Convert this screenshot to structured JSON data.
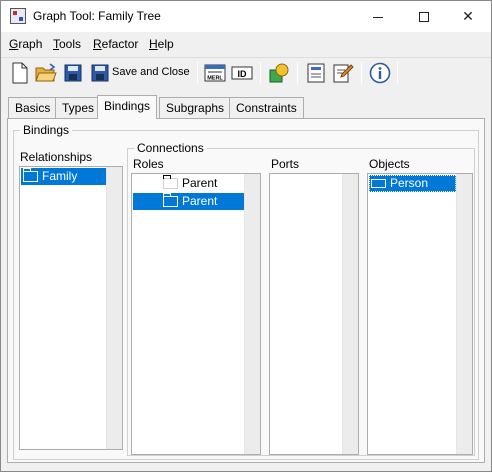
{
  "window": {
    "title": "Graph Tool: Family Tree",
    "controls": {
      "minimize": "minimize",
      "maximize": "maximize",
      "close": "close"
    }
  },
  "menu": {
    "items": [
      {
        "label": "Graph",
        "mnemonic": "G"
      },
      {
        "label": "Tools",
        "mnemonic": "T"
      },
      {
        "label": "Refactor",
        "mnemonic": "R"
      },
      {
        "label": "Help",
        "mnemonic": "H"
      }
    ]
  },
  "toolbar": {
    "save_and_close_label": "Save and Close",
    "merl_label": "MERL",
    "id_label": "ID",
    "icons": [
      "new-document-icon",
      "open-folder-icon",
      "save-disk-icon",
      "save-and-close-icon",
      "merl-icon",
      "id-icon",
      "symbol-shapes-icon",
      "form-icon",
      "edit-pencil-icon",
      "info-icon"
    ]
  },
  "tabs": [
    {
      "label": "Basics",
      "active": false
    },
    {
      "label": "Types",
      "active": false
    },
    {
      "label": "Bindings",
      "active": true
    },
    {
      "label": "Subgraphs",
      "active": false
    },
    {
      "label": "Constraints",
      "active": false
    }
  ],
  "bindings": {
    "group_title": "Bindings",
    "relationships": {
      "label": "Relationships",
      "items": [
        {
          "label": "Family",
          "selected": true
        }
      ]
    },
    "connections": {
      "group_title": "Connections",
      "roles": {
        "label": "Roles",
        "items": [
          {
            "label": "Parent",
            "selected": false
          },
          {
            "label": "Parent",
            "selected": true
          }
        ]
      },
      "ports": {
        "label": "Ports",
        "items": []
      },
      "objects": {
        "label": "Objects",
        "items": [
          {
            "label": "Person",
            "selected": true
          }
        ]
      }
    }
  },
  "colors": {
    "selection": "#0078d7",
    "window_bg": "#f0f0f0",
    "panel_bg": "#f9f9f9"
  }
}
